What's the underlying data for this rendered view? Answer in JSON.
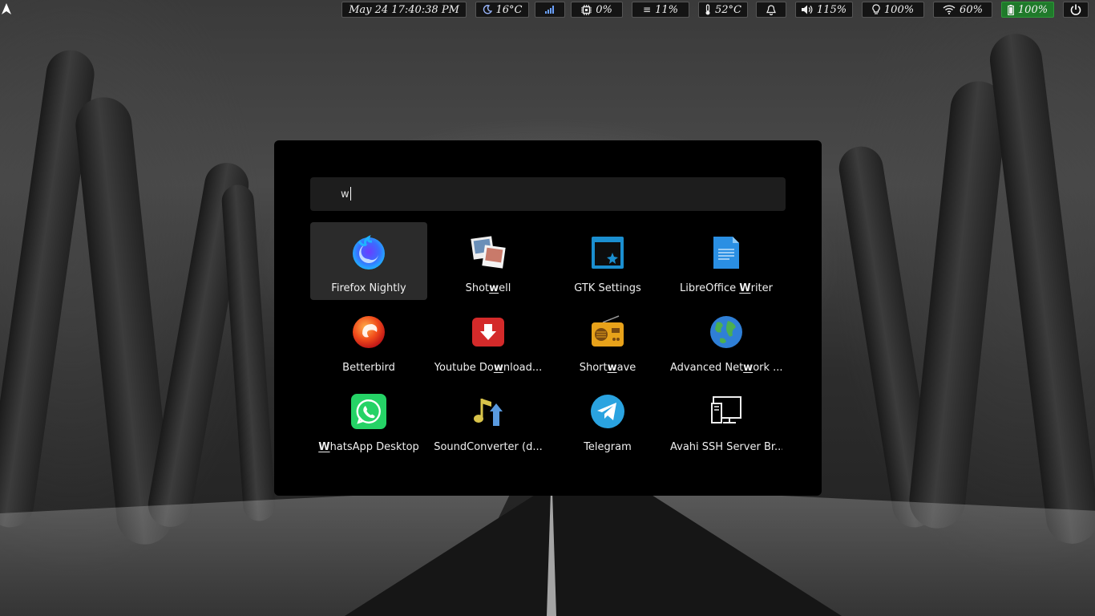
{
  "topbar": {
    "datetime": "May 24 17:40:38 PM",
    "weather": "16°C",
    "network_signal": "",
    "cpu": "0%",
    "memory": "11%",
    "temperature": "52°C",
    "volume": "115%",
    "brightness": "100%",
    "wifi": "60%",
    "battery": "100%",
    "battery_color": "#1f7a2a"
  },
  "launcher": {
    "search_value": "w",
    "apps": [
      {
        "pre": "Firefox Nightly",
        "hl": "",
        "post": "",
        "icon": "firefox-nightly-icon"
      },
      {
        "pre": "Shot",
        "hl": "w",
        "post": "ell",
        "icon": "shotwell-icon"
      },
      {
        "pre": "GTK Settings",
        "hl": "",
        "post": "",
        "icon": "gtk-settings-icon"
      },
      {
        "pre": "LibreOffice ",
        "hl": "W",
        "post": "riter",
        "icon": "libreoffice-writer-icon"
      },
      {
        "pre": "Betterbird",
        "hl": "",
        "post": "",
        "icon": "betterbird-icon"
      },
      {
        "pre": "Youtube Do",
        "hl": "w",
        "post": "nload...",
        "icon": "youtube-downloader-icon"
      },
      {
        "pre": "Short",
        "hl": "w",
        "post": "ave",
        "icon": "shortwave-icon"
      },
      {
        "pre": "Advanced Net",
        "hl": "w",
        "post": "ork ...",
        "icon": "network-globe-icon"
      },
      {
        "pre": "",
        "hl": "W",
        "post": "hatsApp Desktop",
        "icon": "whatsapp-icon"
      },
      {
        "pre": "SoundConverter (d...",
        "hl": "",
        "post": "",
        "icon": "soundconverter-icon"
      },
      {
        "pre": "Telegram",
        "hl": "",
        "post": "",
        "icon": "telegram-icon"
      },
      {
        "pre": "Avahi SSH Server Br...",
        "hl": "",
        "post": "",
        "icon": "avahi-ssh-icon"
      }
    ]
  }
}
